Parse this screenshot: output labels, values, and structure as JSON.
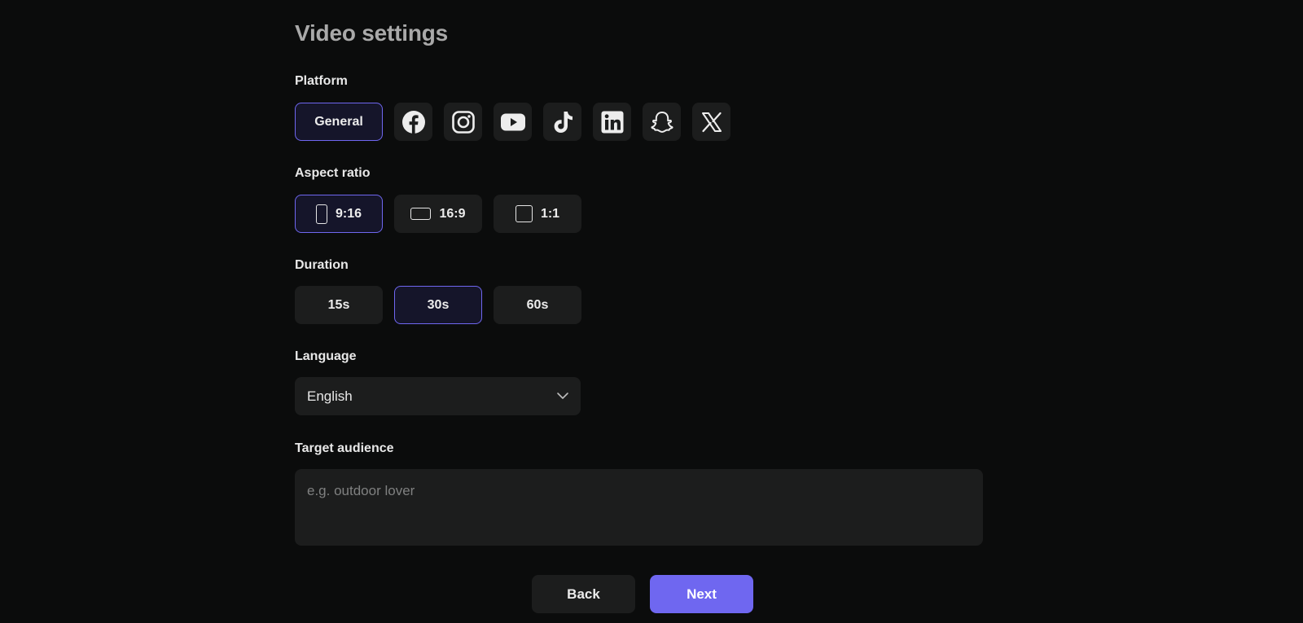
{
  "title": "Video settings",
  "platform": {
    "label": "Platform",
    "selected_label": "General",
    "icons": [
      "facebook-icon",
      "instagram-icon",
      "youtube-icon",
      "tiktok-icon",
      "linkedin-icon",
      "snapchat-icon",
      "x-icon"
    ]
  },
  "aspect_ratio": {
    "label": "Aspect ratio",
    "options": [
      "9:16",
      "16:9",
      "1:1"
    ],
    "selected": "9:16"
  },
  "duration": {
    "label": "Duration",
    "options": [
      "15s",
      "30s",
      "60s"
    ],
    "selected": "30s"
  },
  "language": {
    "label": "Language",
    "value": "English"
  },
  "target_audience": {
    "label": "Target audience",
    "placeholder": "e.g. outdoor lover",
    "value": ""
  },
  "buttons": {
    "back": "Back",
    "next": "Next"
  },
  "colors": {
    "accent": "#6f67f0",
    "background": "#0b0c0c",
    "surface": "#1c1d1d"
  }
}
